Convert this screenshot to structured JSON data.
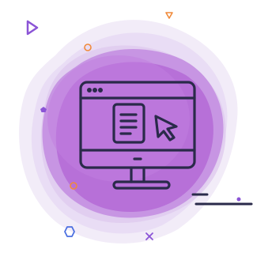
{
  "illustration": {
    "subject": "desktop-monitor-with-document-and-cursor-icon",
    "colors": {
      "background": "#ffffff",
      "blob_outer": "#efe7f7",
      "blob_mid": "#e3d3f1",
      "blob_inner": "#c98be6",
      "blob_core": "#a857cf",
      "line_art": "#2a2a4a",
      "accent_purple": "#8b54d6",
      "accent_orange": "#f08a3a",
      "accent_blue": "#4b6fe0"
    },
    "decorations": [
      "play-triangle-icon",
      "orange-triangle-icon",
      "orange-circle-icon",
      "purple-pentagon-icon",
      "orange-ring-icon",
      "blue-hexagon-icon",
      "purple-x-icon",
      "dash-lines-icon",
      "small-dot-icon"
    ]
  }
}
